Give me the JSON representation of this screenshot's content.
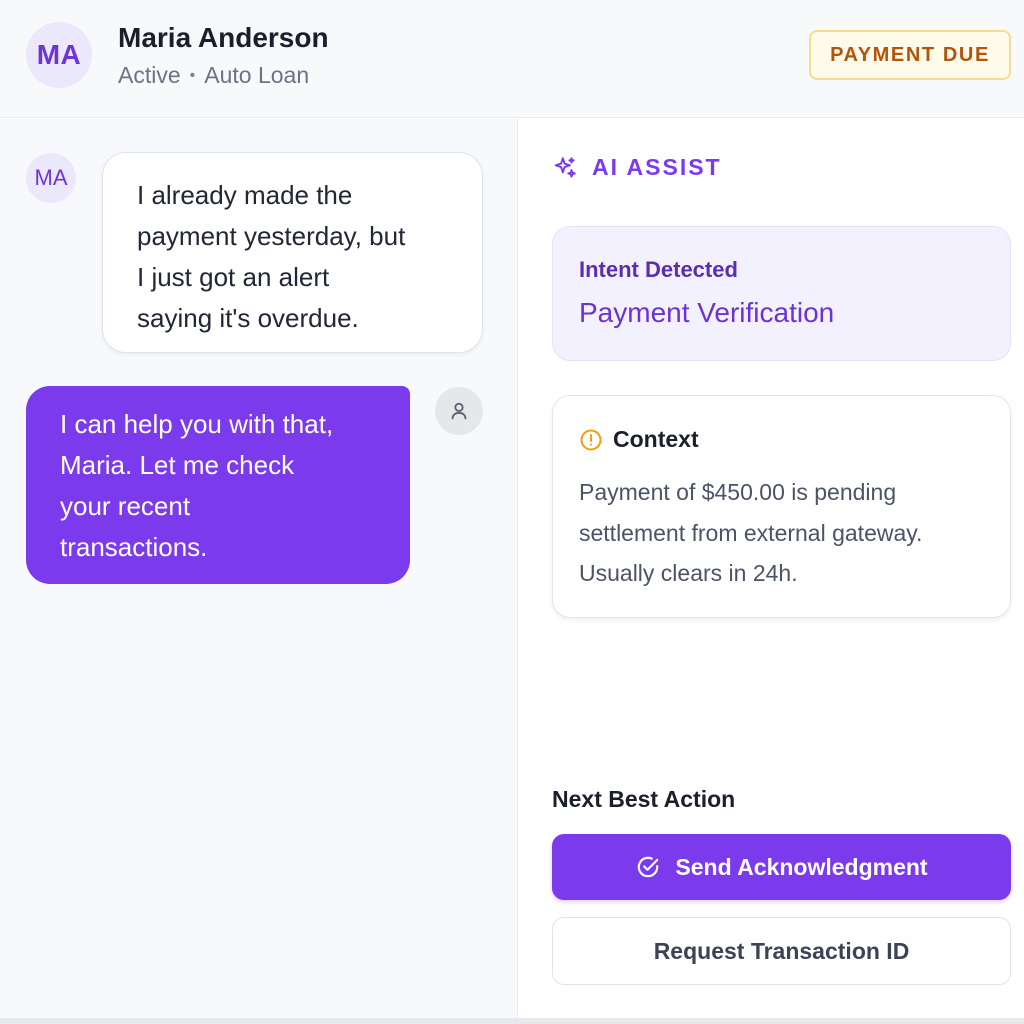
{
  "header": {
    "avatar_initials": "MA",
    "customer_name": "Maria Anderson",
    "status": "Active",
    "separator": "•",
    "product": "Auto Loan",
    "badge": "PAYMENT DUE"
  },
  "chat": {
    "messages": [
      {
        "sender": "customer",
        "avatar_initials": "MA",
        "lines": [
          "I already made the",
          "payment yesterday, but",
          "I just got an alert",
          "saying it's overdue."
        ]
      },
      {
        "sender": "agent",
        "avatar_icon": "user-icon",
        "lines": [
          "I can help you with that,",
          "Maria. Let me check",
          "your recent",
          "transactions."
        ]
      }
    ]
  },
  "assist": {
    "title_icon": "sparkles-icon",
    "title": "AI ASSIST",
    "intent": {
      "label": "Intent Detected",
      "value": "Payment Verification"
    },
    "context": {
      "icon": "alert-circle-icon",
      "title": "Context",
      "lines": [
        "Payment of $450.00 is pending",
        "settlement from external gateway.",
        "Usually clears in 24h."
      ]
    },
    "next_best_action": {
      "label": "Next Best Action",
      "primary_icon": "check-circle-icon",
      "primary": "Send Acknowledgment",
      "secondary": "Request Transaction ID"
    }
  },
  "colors": {
    "accent": "#7c3aed",
    "badge_text": "#b45309",
    "badge_border": "#f5dd8f",
    "warning_icon": "#f59e0b"
  }
}
